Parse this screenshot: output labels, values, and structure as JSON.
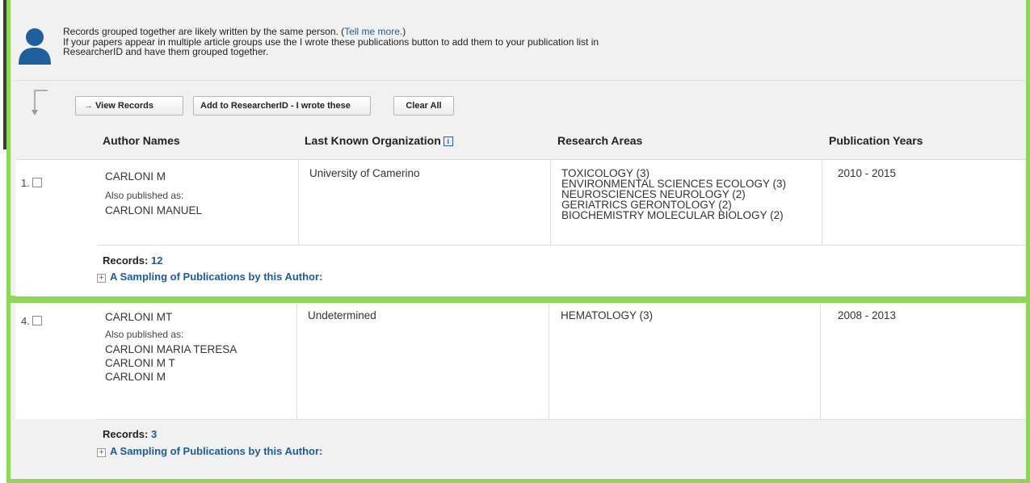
{
  "info": {
    "line1_prefix": "Records grouped together are likely written by the same person. (",
    "tell_me_more": "Tell me more.",
    "line1_suffix": ")",
    "line2": "If your papers appear in multiple article groups use the I wrote these publications button to add them to your publication list in",
    "line3": "ResearcherID and have them grouped together."
  },
  "toolbar": {
    "view_records": "View Records",
    "add_researcherid": "Add to ResearcherID - I wrote these",
    "clear_all": "Clear All"
  },
  "columns": {
    "author_names": "Author Names",
    "last_known_org": "Last Known Organization",
    "info_glyph": "i",
    "research_areas": "Research Areas",
    "publication_years": "Publication Years"
  },
  "rows": [
    {
      "index": "1.",
      "author": "CARLONI M",
      "also_label": "Also published as:",
      "aliases": [
        "CARLONI MANUEL"
      ],
      "organization": "University of Camerino",
      "areas": [
        "TOXICOLOGY (3)",
        "ENVIRONMENTAL SCIENCES ECOLOGY (3)",
        "NEUROSCIENCES NEUROLOGY (2)",
        "GERIATRICS GERONTOLOGY (2)",
        "BIOCHEMISTRY MOLECULAR BIOLOGY (2)"
      ],
      "years": "2010 - 2015",
      "records_label": "Records:",
      "records_count": "12",
      "sampling": "A Sampling of Publications by this Author:"
    },
    {
      "index": "4.",
      "author": "CARLONI MT",
      "also_label": "Also published as:",
      "aliases": [
        "CARLONI MARIA TERESA",
        "CARLONI M T",
        "CARLONI M"
      ],
      "organization": "Undetermined",
      "areas": [
        "HEMATOLOGY (3)"
      ],
      "years": "2008 - 2013",
      "records_label": "Records:",
      "records_count": "3",
      "sampling": "A Sampling of Publications by this Author:"
    }
  ],
  "icons": {
    "person": "person-silhouette-icon",
    "arrow": "down-arrow-icon",
    "expand": "plus-icon",
    "view_arrow": "→"
  },
  "colors": {
    "highlight_frame": "#8dd65a",
    "link": "#1f5a96",
    "person_icon": "#1e5f9c"
  }
}
